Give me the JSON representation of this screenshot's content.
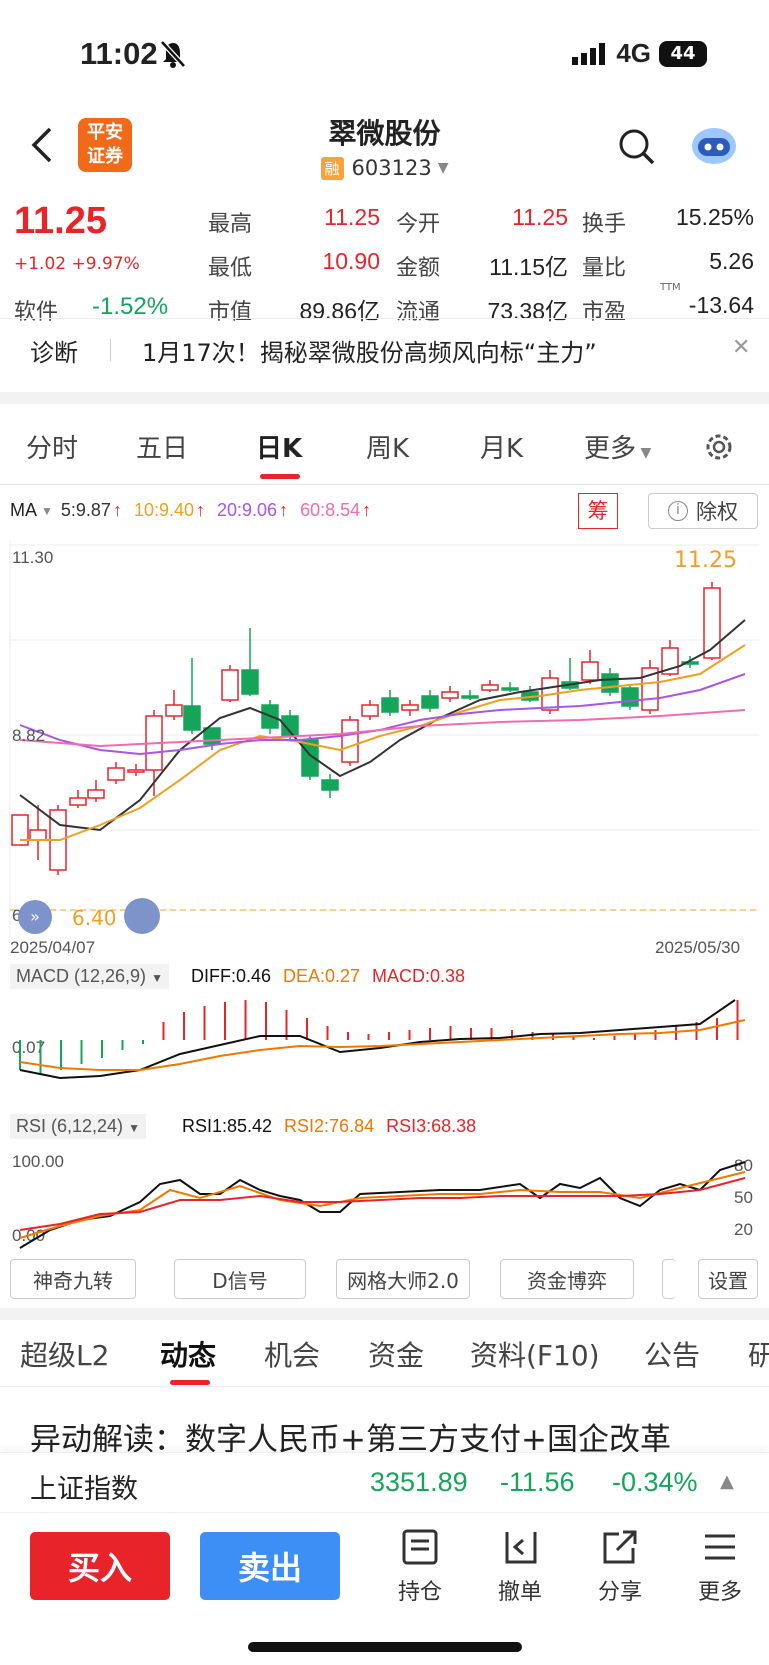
{
  "status": {
    "time": "11:02",
    "network": "4G",
    "battery": "44"
  },
  "header": {
    "name": "翠微股份",
    "code": "603123",
    "badge": "融",
    "logo_line1": "平安",
    "logo_line2": "证券"
  },
  "quote": {
    "price": "11.25",
    "change": "+1.02 +9.97%",
    "sector_label": "软件",
    "sector_change": "-1.52%",
    "high_label": "最高",
    "high": "11.25",
    "open_label": "今开",
    "open": "11.25",
    "turnover_label": "换手",
    "turnover": "15.25%",
    "low_label": "最低",
    "low": "10.90",
    "amount_label": "金额",
    "amount": "11.15亿",
    "volratio_label": "量比",
    "volratio": "5.26",
    "mcap_label": "市值",
    "mcap": "89.86亿",
    "float_label": "流通",
    "float": "73.38亿",
    "pe_label": "市盈",
    "pe_sup": "TTM",
    "pe": "-13.64"
  },
  "news": {
    "tag": "诊断",
    "text": "1月17次！揭秘翠微股份高频风向标“主力”"
  },
  "tabs": [
    "分时",
    "五日",
    "日K",
    "周K",
    "月K",
    "更多"
  ],
  "ma": {
    "label": "MA",
    "ma5": "5:9.87",
    "ma10": "10:9.40",
    "ma20": "20:9.06",
    "ma60": "60:8.54",
    "chou": "筹",
    "chuquan": "除权"
  },
  "kchart": {
    "top_price": "11.30",
    "mid_price": "8.82",
    "low_price": "6.35",
    "low_mark": "6.40",
    "last_price": "11.25",
    "date_start": "2025/04/07",
    "date_end": "2025/05/30"
  },
  "macd": {
    "label": "MACD (12,26,9)",
    "diff": "DIFF:0.46",
    "dea": "DEA:0.27",
    "macd": "MACD:0.38",
    "axis": "0.07"
  },
  "rsi": {
    "label": "RSI (6,12,24)",
    "rsi1": "RSI1:85.42",
    "rsi2": "RSI2:76.84",
    "rsi3": "RSI3:68.38",
    "top": "100.00",
    "bottom": "0.00",
    "r80": "80",
    "r50": "50",
    "r20": "20"
  },
  "tools": [
    "神奇九转",
    "D信号",
    "网格大师2.0",
    "资金博弈",
    "设置"
  ],
  "ftabs": [
    "超级L2",
    "动态",
    "机会",
    "资金",
    "资料(F10)",
    "公告",
    "研"
  ],
  "headline": "异动解读：数字人民币+第三方支付+国企改革",
  "index": {
    "name": "上证指数",
    "value": "3351.89",
    "change": "-11.56",
    "pct": "-0.34%"
  },
  "actions": {
    "buy": "买入",
    "sell": "卖出",
    "hold": "持仓",
    "cancel": "撤单",
    "share": "分享",
    "more": "更多"
  },
  "colors": {
    "up": "#e8242a",
    "down": "#14a55a",
    "accent": "#e8242a",
    "sell_blue": "#3d8ff5"
  }
}
